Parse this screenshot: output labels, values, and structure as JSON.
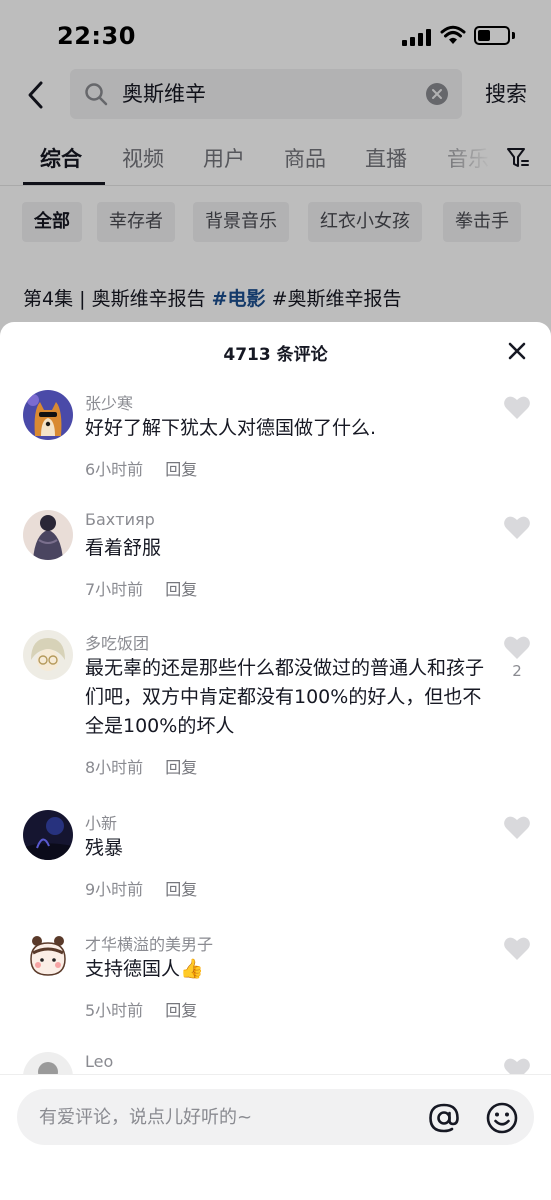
{
  "status_bar": {
    "time": "22:30"
  },
  "search": {
    "query": "奥斯维辛",
    "button_label": "搜索"
  },
  "tabs": [
    {
      "label": "综合"
    },
    {
      "label": "视频"
    },
    {
      "label": "用户"
    },
    {
      "label": "商品"
    },
    {
      "label": "直播"
    },
    {
      "label": "音乐"
    }
  ],
  "chips": [
    {
      "label": "全部"
    },
    {
      "label": "幸存者"
    },
    {
      "label": "背景音乐"
    },
    {
      "label": "红衣小女孩"
    },
    {
      "label": "拳击手"
    }
  ],
  "video": {
    "title_prefix": "第4集 | 奥斯维辛报告 ",
    "tag": "#电影",
    "title_suffix": " #奥斯维辛报告"
  },
  "sheet": {
    "title": "4713 条评论",
    "reply_label": "回复",
    "input_placeholder": "有爱评论，说点儿好听的~"
  },
  "comments": [
    {
      "user": "张少寒",
      "text": "好好了解下犹太人对德国做了什么.",
      "time": "6小时前",
      "likes": ""
    },
    {
      "user": "Бахтияр",
      "text": "看着舒服",
      "time": "7小时前",
      "likes": ""
    },
    {
      "user": "多吃饭团",
      "text": "最无辜的还是那些什么都没做过的普通人和孩子们吧，双方中肯定都没有100%的好人，但也不全是100%的坏人",
      "time": "8小时前",
      "likes": "2"
    },
    {
      "user": "小新",
      "text": "残暴",
      "time": "9小时前",
      "likes": ""
    },
    {
      "user": "才华横溢的美男子",
      "text": "支持德国人👍",
      "time": "5小时前",
      "likes": ""
    },
    {
      "user": "Leo",
      "text": "",
      "time": "",
      "likes": ""
    }
  ],
  "colors": {
    "text_primary": "#161823",
    "text_secondary": "#8a8b91",
    "hashtag": "#1c4f8f",
    "surface": "#f1f1f2"
  }
}
